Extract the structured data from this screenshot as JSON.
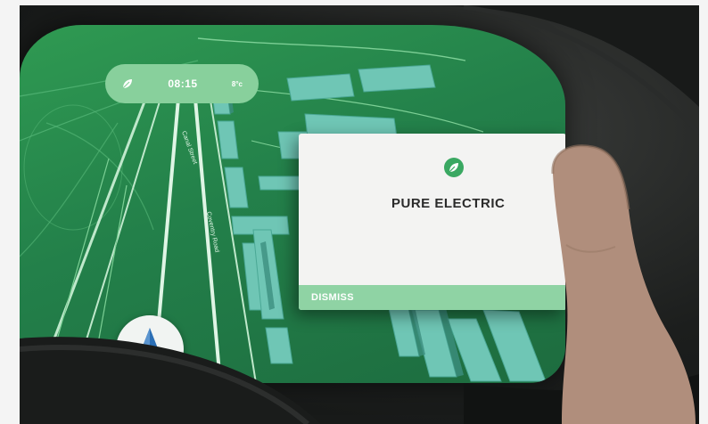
{
  "status_bar": {
    "mode_icon": "leaf-icon",
    "time": "08:15",
    "unit": "8°c"
  },
  "popup": {
    "icon": "leaf-icon",
    "title": "PURE ELECTRIC",
    "dismiss_label": "DISMISS"
  },
  "nav": {
    "arrow_icon": "navigation-arrow-icon"
  },
  "map": {
    "street_labels": [
      "Canal Street",
      "Coventry Road"
    ]
  },
  "colors": {
    "map_green": "#23804a",
    "accent_mint": "#88d09c",
    "popup_bg": "#f3f3f2",
    "arrow_blue": "#2b6fb5"
  }
}
